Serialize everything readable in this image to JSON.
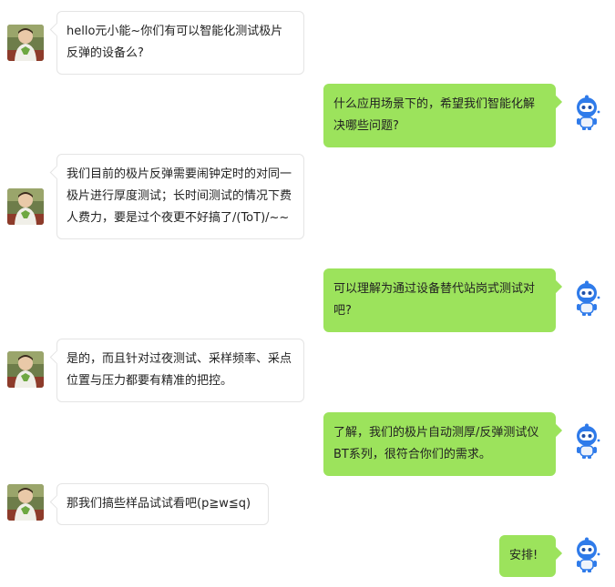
{
  "colors": {
    "user_bubble_bg": "#ffffff",
    "user_bubble_border": "#e4e4e4",
    "bot_bubble_bg": "#9ce35c",
    "text": "#222222",
    "robot_blue": "#2f7bea"
  },
  "conversation": {
    "messages": [
      {
        "sender": "customer",
        "avatar": "customer-photo-avatar",
        "text": "hello元小能~你们有可以智能化测试极片反弹的设备么?"
      },
      {
        "sender": "assistant",
        "avatar": "robot-mascot-icon",
        "text": "什么应用场景下的，希望我们智能化解决哪些问题?"
      },
      {
        "sender": "customer",
        "avatar": "customer-photo-avatar",
        "text": "我们目前的极片反弹需要闹钟定时的对同一极片进行厚度测试；长时间测试的情况下费人费力，要是过个夜更不好搞了/(ToT)/~~"
      },
      {
        "sender": "assistant",
        "avatar": "robot-mascot-icon",
        "text": "可以理解为通过设备替代站岗式测试对吧?"
      },
      {
        "sender": "customer",
        "avatar": "customer-photo-avatar",
        "text": "是的，而且针对过夜测试、采样频率、采点位置与压力都要有精准的把控。"
      },
      {
        "sender": "assistant",
        "avatar": "robot-mascot-icon",
        "text": "了解，我们的极片自动测厚/反弹测试仪BT系列，很符合你们的需求。"
      },
      {
        "sender": "customer",
        "avatar": "customer-photo-avatar",
        "text": "那我们搞些样品试试看吧(p≧w≦q)"
      },
      {
        "sender": "assistant",
        "avatar": "robot-mascot-icon",
        "text": "安排!"
      }
    ]
  }
}
